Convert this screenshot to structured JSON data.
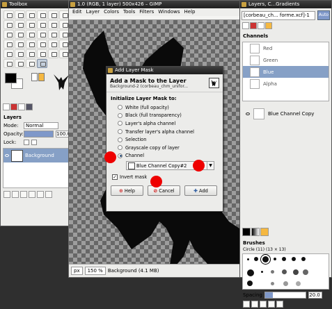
{
  "toolbox": {
    "title": "Toolbox",
    "layers_panel": {
      "title": "Layers",
      "mode_label": "Mode:",
      "mode_value": "Normal",
      "opacity_label": "Opacity:",
      "opacity_value": "100.0",
      "opacity_fraction": 1.0,
      "lock_label": "Lock:",
      "layer_name": "Background"
    }
  },
  "image_window": {
    "title": "1.0 (RGB, 1 layer) 500x426 – GIMP",
    "menu": [
      "Edit",
      "Layer",
      "Colors",
      "Tools",
      "Filters",
      "Windows",
      "Help"
    ],
    "status": {
      "unit": "px",
      "zoom": "150 %",
      "info": "Background (4.1 MB)"
    }
  },
  "dock": {
    "title": "Layers, C...Gradients",
    "image_selector": "[corbeau_ch... forme.xcf]-1",
    "auto_label": "Auto",
    "channels_title": "Channels",
    "channels": [
      "Red",
      "Green",
      "Blue",
      "Alpha"
    ],
    "selected_channel": "Blue",
    "saved_channel": "Blue Channel Copy",
    "brushes_title": "Brushes",
    "brush_info": "Circle (11) (13 × 13)",
    "spacing_label": "Spacing",
    "spacing_value": "20.0"
  },
  "dialog": {
    "window_title": "Add Layer Mask",
    "heading": "Add a Mask to the Layer",
    "subheading": "Background-2 (corbeau_chm_unifor...",
    "section_title": "Initialize Layer Mask to:",
    "options": [
      "White (full opacity)",
      "Black (full transparency)",
      "Layer's alpha channel",
      "Transfer layer's alpha channel",
      "Selection",
      "Grayscale copy of layer",
      "Channel"
    ],
    "selected_option": "Channel",
    "channel_value": "Blue Channel Copy#2",
    "invert_label": "Invert mask",
    "invert_checked": true,
    "help_label": "Help",
    "cancel_label": "Cancel",
    "add_label": "Add"
  }
}
